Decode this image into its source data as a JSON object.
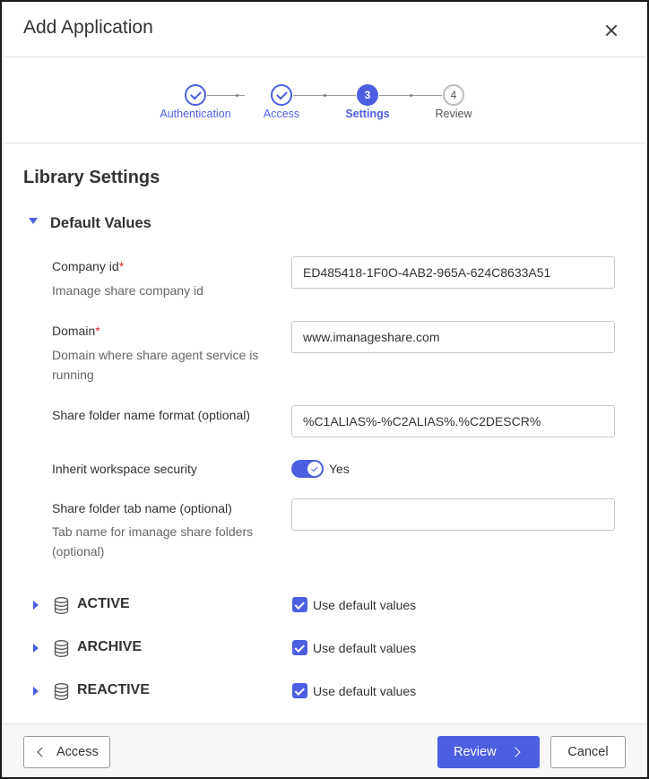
{
  "dialog": {
    "title": "Add Application",
    "close_icon": "close-icon"
  },
  "stepper": {
    "steps": [
      {
        "number": "1",
        "label": "Authentication",
        "state": "done"
      },
      {
        "number": "2",
        "label": "Access",
        "state": "done"
      },
      {
        "number": "3",
        "label": "Settings",
        "state": "current"
      },
      {
        "number": "4",
        "label": "Review",
        "state": "todo"
      }
    ]
  },
  "main": {
    "section_title": "Library Settings",
    "group_title": "Default Values",
    "fields": {
      "company_id": {
        "label": "Company id",
        "required_mark": "*",
        "help": "Imanage share company id",
        "value": "ED485418-1F0O-4AB2-965A-624C8633A51"
      },
      "domain": {
        "label": "Domain",
        "required_mark": "*",
        "help": "Domain where share agent service is running",
        "value": "www.imanageshare.com"
      },
      "folder_format": {
        "label": "Share folder name format (optional)",
        "value": "%C1ALIAS%-%C2ALIAS%.%C2DESCR%"
      },
      "inherit_security": {
        "label": "Inherit workspace security",
        "toggle_text": "Yes",
        "checked": true
      },
      "tab_name": {
        "label": "Share folder tab name (optional)",
        "help": "Tab name for imanage share folders (optional)",
        "value": ""
      }
    },
    "libraries": [
      {
        "name": "ACTIVE",
        "checkbox_label": "Use default values",
        "checked": true
      },
      {
        "name": "ARCHIVE",
        "checkbox_label": "Use default values",
        "checked": true
      },
      {
        "name": "REACTIVE",
        "checkbox_label": "Use default values",
        "checked": true
      }
    ]
  },
  "footer": {
    "back_label": "Access",
    "review_label": "Review",
    "cancel_label": "Cancel"
  },
  "colors": {
    "accent": "#4c5fe0",
    "required": "#d02c2c"
  }
}
